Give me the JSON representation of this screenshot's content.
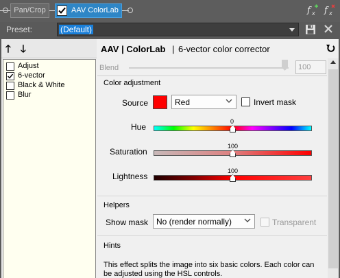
{
  "chain": {
    "pan_crop": "Pan/Crop",
    "active_effect": "AAV ColorLab",
    "active_checked": true
  },
  "preset": {
    "label": "Preset:",
    "value": "(Default)"
  },
  "effects_list": [
    {
      "label": "Adjust",
      "checked": false
    },
    {
      "label": "6-vector",
      "checked": true
    },
    {
      "label": "Black & White",
      "checked": false
    },
    {
      "label": "Blur",
      "checked": false
    }
  ],
  "header": {
    "plugin": "AAV | ColorLab",
    "separator": "|",
    "effect": "6-vector color corrector"
  },
  "blend": {
    "label": "Blend",
    "value": "100",
    "level_percent": 100
  },
  "color_adjustment": {
    "title": "Color adjustment",
    "source_label": "Source",
    "source_value": "Red",
    "swatch_color": "#ff0000",
    "invert_mask_label": "Invert mask",
    "invert_mask_checked": false,
    "hue": {
      "label": "Hue",
      "value": "0",
      "level": 0.5
    },
    "saturation": {
      "label": "Saturation",
      "value": "100",
      "level": 0.5
    },
    "lightness": {
      "label": "Lightness",
      "value": "100",
      "level": 0.5
    }
  },
  "helpers": {
    "title": "Helpers",
    "show_mask_label": "Show mask",
    "show_mask_value": "No (render normally)",
    "transparent_label": "Transparent",
    "transparent_checked": false
  },
  "hints": {
    "title": "Hints",
    "text": "This effect splits the image into six basic colors. Each color can be adjusted using the HSL controls."
  },
  "colors": {
    "accent": "#2e86c6",
    "selection": "#1a7fd9",
    "list_bg": "#fffff0",
    "panel_bg": "#f0f0f0",
    "toolbar_bg": "#5a5a5a"
  }
}
